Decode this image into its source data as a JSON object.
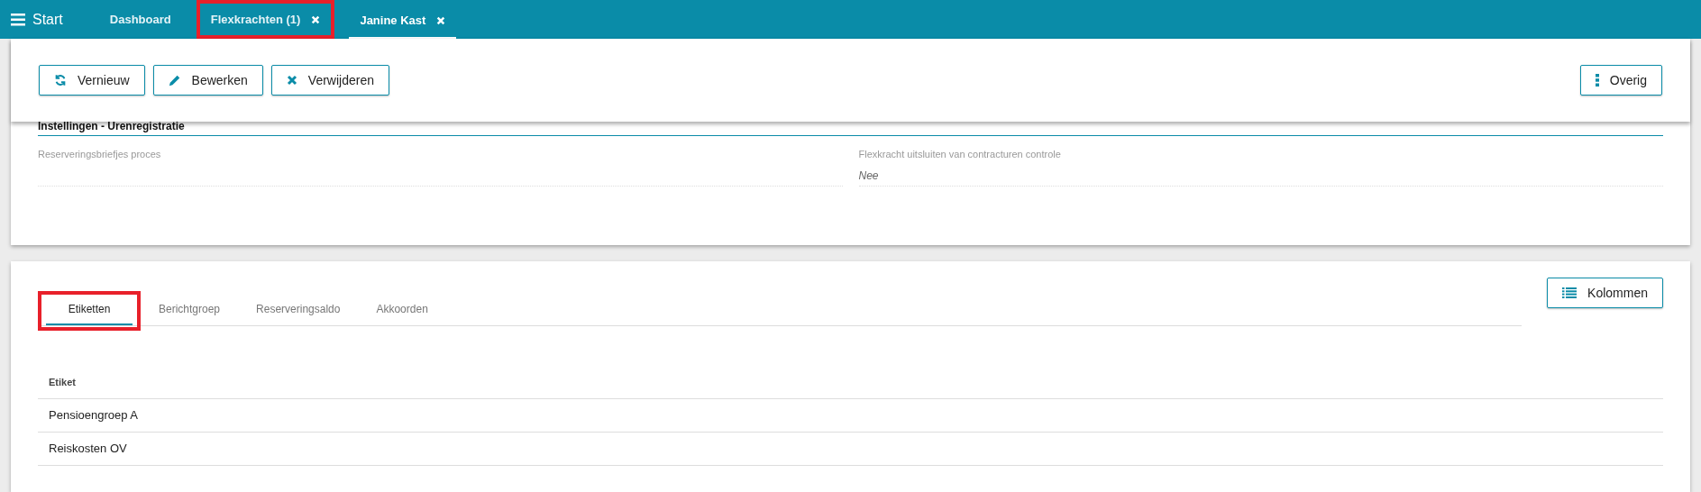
{
  "top_bar": {
    "menu_label": "Start",
    "tabs": [
      {
        "label": "Dashboard",
        "selected": false,
        "closable": false,
        "highlighted": false
      },
      {
        "label": "Flexkrachten (1)",
        "selected": false,
        "closable": true,
        "highlighted": true
      },
      {
        "label": "Janine Kast",
        "selected": true,
        "closable": true,
        "highlighted": false
      }
    ]
  },
  "toolbar": {
    "buttons": [
      {
        "label": "Vernieuw",
        "kind": "refresh"
      },
      {
        "label": "Bewerken",
        "kind": "edit"
      },
      {
        "label": "Verwijderen",
        "kind": "delete"
      }
    ],
    "more_button": "Overig"
  },
  "section": {
    "title": "Instellingen - Urenregistratie",
    "fields": [
      {
        "label": "Reserveringsbriefjes proces"
      },
      {
        "label": "Flexkracht uitsluiten van contracturen controle",
        "value": "Nee"
      }
    ]
  },
  "detail_tabs": [
    {
      "label": "Etiketten",
      "selected": true,
      "highlighted": true
    },
    {
      "label": "Berichtgroep",
      "selected": false,
      "highlighted": false
    },
    {
      "label": "Reserveringsaldo",
      "selected": false,
      "highlighted": false
    },
    {
      "label": "Akkoorden",
      "selected": false,
      "highlighted": false
    }
  ],
  "columns_button": "Kolommen",
  "table": {
    "columns": [
      "Etiket"
    ],
    "rows": [
      [
        "Pensioengroep A"
      ],
      [
        "Reiskosten OV"
      ]
    ]
  }
}
